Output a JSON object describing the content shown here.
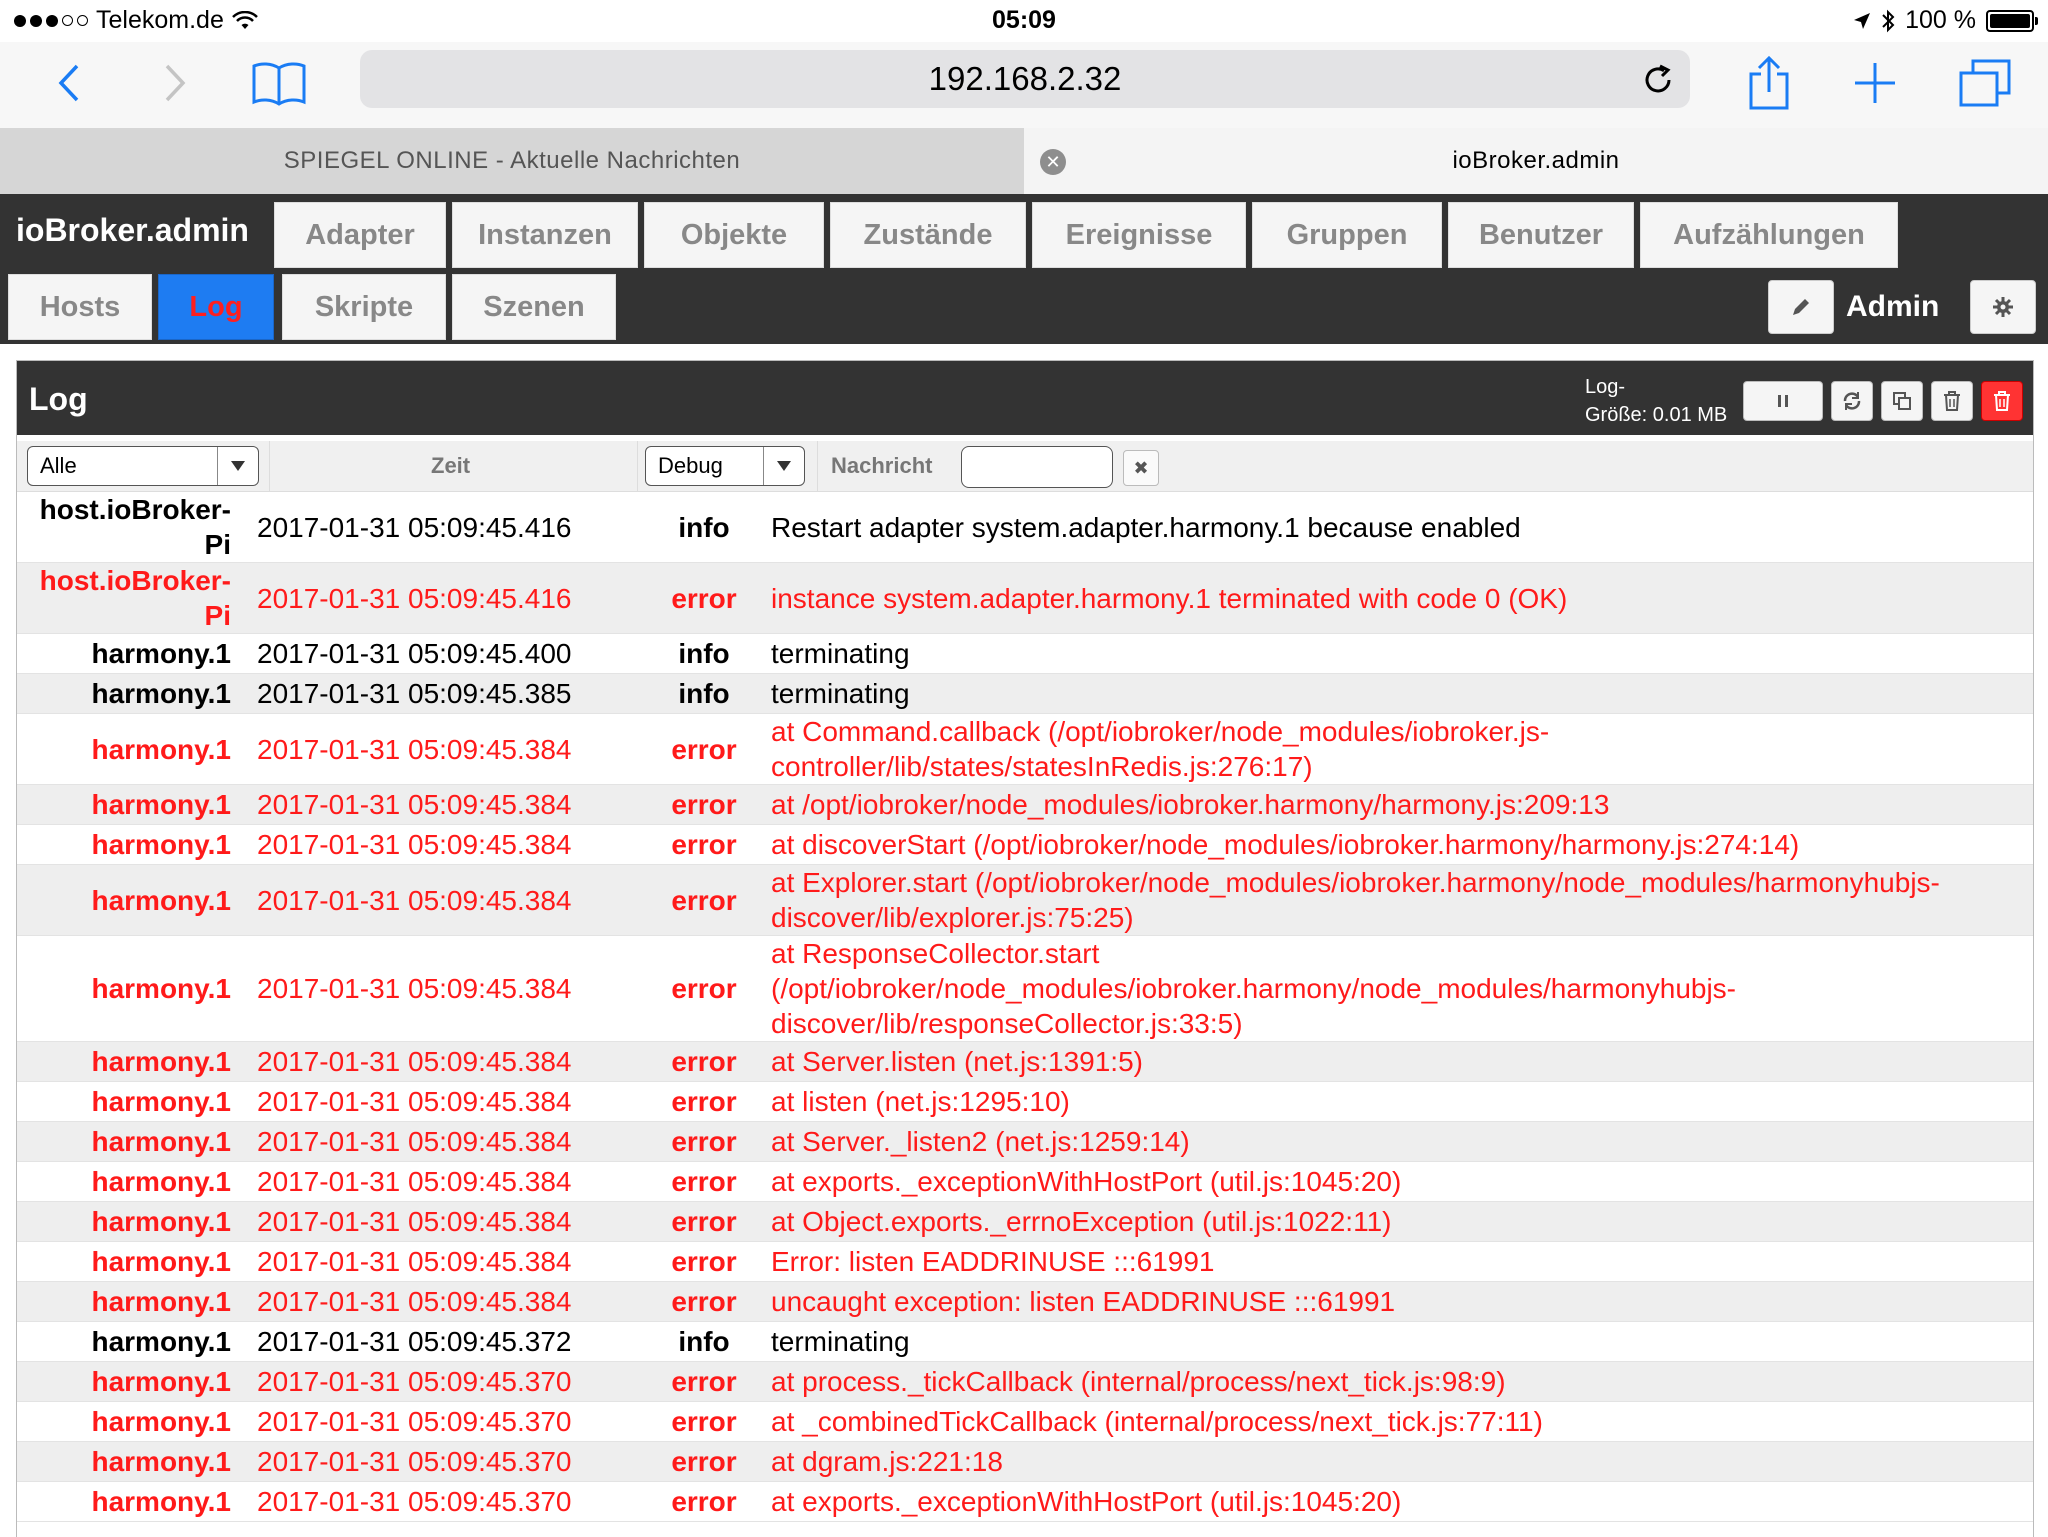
{
  "statusbar": {
    "carrier": "Telekom.de",
    "time": "05:09",
    "battery": "100 %",
    "colors": {
      "text": "#000000"
    }
  },
  "safari": {
    "url": "192.168.2.32",
    "tabs": [
      {
        "title": "SPIEGEL ONLINE - Aktuelle Nachrichten",
        "active": false
      },
      {
        "title": "ioBroker.admin",
        "active": true
      }
    ],
    "icons": [
      "back-icon",
      "forward-icon",
      "bookmarks-icon",
      "reload-icon",
      "share-icon",
      "plus-icon",
      "tabs-icon",
      "close-tab-icon"
    ],
    "colors": {
      "accent": "#1a7cf4"
    }
  },
  "app": {
    "title": "ioBroker.admin",
    "nav_row1": [
      "Adapter",
      "Instanzen",
      "Objekte",
      "Zustände",
      "Ereignisse",
      "Gruppen",
      "Benutzer",
      "Aufzählungen"
    ],
    "nav_row2": [
      "Hosts",
      "Log",
      "Skripte",
      "Szenen"
    ],
    "active_tab": "Log",
    "user": "Admin",
    "colors": {
      "header_bg": "#333333",
      "active_tab_bg": "#1e7cf2",
      "active_tab_text": "#ff1f1f"
    }
  },
  "log": {
    "title": "Log",
    "size_label": "Log-",
    "size_value": "Größe: 0.01 MB",
    "filter": {
      "source_value": "Alle",
      "time_header": "Zeit",
      "severity_value": "Debug",
      "message_header": "Nachricht",
      "message_value": ""
    },
    "colors": {
      "error": "#ff1a1a",
      "info": "#000000",
      "row_alt": "#eeeeee"
    },
    "rows": [
      {
        "source": "host.ioBroker-Pi",
        "time": "2017-01-31 05:09:45.416",
        "severity": "info",
        "message": "Restart adapter system.adapter.harmony.1 because enabled"
      },
      {
        "source": "host.ioBroker-Pi",
        "time": "2017-01-31 05:09:45.416",
        "severity": "error",
        "message": "instance system.adapter.harmony.1 terminated with code 0 (OK)"
      },
      {
        "source": "harmony.1",
        "time": "2017-01-31 05:09:45.400",
        "severity": "info",
        "message": "terminating"
      },
      {
        "source": "harmony.1",
        "time": "2017-01-31 05:09:45.385",
        "severity": "info",
        "message": "terminating"
      },
      {
        "source": "harmony.1",
        "time": "2017-01-31 05:09:45.384",
        "severity": "error",
        "message": "at Command.callback (/opt/iobroker/node_modules/iobroker.js-controller/lib/states/statesInRedis.js:276:17)"
      },
      {
        "source": "harmony.1",
        "time": "2017-01-31 05:09:45.384",
        "severity": "error",
        "message": "at /opt/iobroker/node_modules/iobroker.harmony/harmony.js:209:13"
      },
      {
        "source": "harmony.1",
        "time": "2017-01-31 05:09:45.384",
        "severity": "error",
        "message": "at discoverStart (/opt/iobroker/node_modules/iobroker.harmony/harmony.js:274:14)"
      },
      {
        "source": "harmony.1",
        "time": "2017-01-31 05:09:45.384",
        "severity": "error",
        "message": "at Explorer.start (/opt/iobroker/node_modules/iobroker.harmony/node_modules/harmonyhubjs-discover/lib/explorer.js:75:25)"
      },
      {
        "source": "harmony.1",
        "time": "2017-01-31 05:09:45.384",
        "severity": "error",
        "message": "at ResponseCollector.start (/opt/iobroker/node_modules/iobroker.harmony/node_modules/harmonyhubjs-discover/lib/responseCollector.js:33:5)"
      },
      {
        "source": "harmony.1",
        "time": "2017-01-31 05:09:45.384",
        "severity": "error",
        "message": "at Server.listen (net.js:1391:5)"
      },
      {
        "source": "harmony.1",
        "time": "2017-01-31 05:09:45.384",
        "severity": "error",
        "message": "at listen (net.js:1295:10)"
      },
      {
        "source": "harmony.1",
        "time": "2017-01-31 05:09:45.384",
        "severity": "error",
        "message": "at Server._listen2 (net.js:1259:14)"
      },
      {
        "source": "harmony.1",
        "time": "2017-01-31 05:09:45.384",
        "severity": "error",
        "message": "at exports._exceptionWithHostPort (util.js:1045:20)"
      },
      {
        "source": "harmony.1",
        "time": "2017-01-31 05:09:45.384",
        "severity": "error",
        "message": "at Object.exports._errnoException (util.js:1022:11)"
      },
      {
        "source": "harmony.1",
        "time": "2017-01-31 05:09:45.384",
        "severity": "error",
        "message": "Error: listen EADDRINUSE :::61991"
      },
      {
        "source": "harmony.1",
        "time": "2017-01-31 05:09:45.384",
        "severity": "error",
        "message": "uncaught exception: listen EADDRINUSE :::61991"
      },
      {
        "source": "harmony.1",
        "time": "2017-01-31 05:09:45.372",
        "severity": "info",
        "message": "terminating"
      },
      {
        "source": "harmony.1",
        "time": "2017-01-31 05:09:45.370",
        "severity": "error",
        "message": "at process._tickCallback (internal/process/next_tick.js:98:9)"
      },
      {
        "source": "harmony.1",
        "time": "2017-01-31 05:09:45.370",
        "severity": "error",
        "message": "at _combinedTickCallback (internal/process/next_tick.js:77:11)"
      },
      {
        "source": "harmony.1",
        "time": "2017-01-31 05:09:45.370",
        "severity": "error",
        "message": "at dgram.js:221:18"
      },
      {
        "source": "harmony.1",
        "time": "2017-01-31 05:09:45.370",
        "severity": "error",
        "message": "at exports._exceptionWithHostPort (util.js:1045:20)"
      }
    ]
  }
}
